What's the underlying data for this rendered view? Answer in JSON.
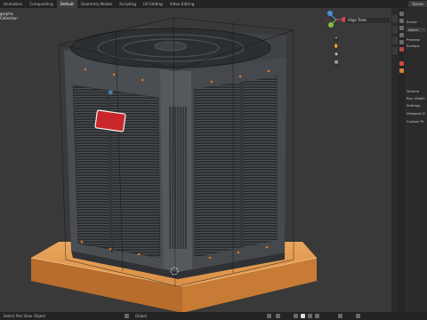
{
  "tabs": [
    "Animation",
    "Compositing",
    "Default",
    "Geometry Nodes",
    "Scripting",
    "UV Editing",
    "Video Editing"
  ],
  "active_tab_index": 2,
  "scene_label": "Scene",
  "viewport": {
    "mode_lines": [
      "graphic",
      "Collection"
    ],
    "align_tools_label": "Align Tools"
  },
  "properties": {
    "scene_row": "Scene",
    "world_field": "World",
    "preview_row": "Preview",
    "surface_row": "Surface",
    "sections": [
      "Volume",
      "Ray Visibili",
      "Settings",
      "Viewport D",
      "Custom Pr"
    ]
  },
  "status": {
    "left_items": [
      "Select",
      "Pan View",
      "Object"
    ],
    "global_label": "Global"
  },
  "colors": {
    "viewport_bg": "#393939",
    "selection_red": "#c8262b",
    "pad_orange": "#e5a055"
  }
}
